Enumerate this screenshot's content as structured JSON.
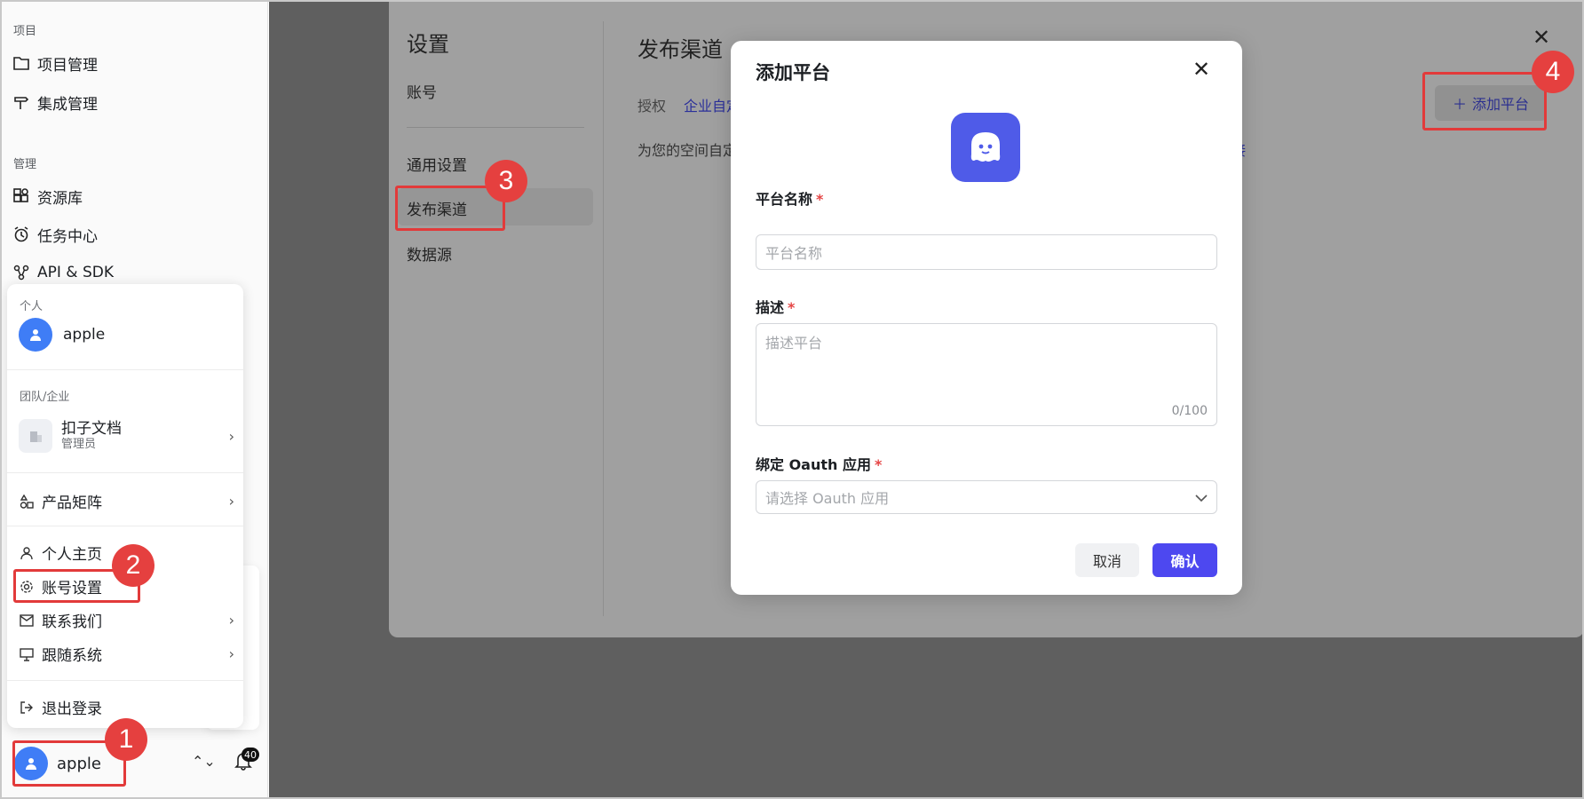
{
  "sidebar": {
    "section_project": "项目",
    "items_project": [
      {
        "label": "项目管理",
        "icon": "folder-icon"
      },
      {
        "label": "集成管理",
        "icon": "signpost-icon"
      }
    ],
    "section_manage": "管理",
    "items_manage": [
      {
        "label": "资源库",
        "icon": "blocks-icon"
      },
      {
        "label": "任务中心",
        "icon": "alarm-icon"
      },
      {
        "label": "API & SDK",
        "icon": "nodes-icon"
      }
    ],
    "user": {
      "name": "apple",
      "notification_count": "40"
    }
  },
  "account_menu": {
    "personal_label": "个人",
    "personal_name": "apple",
    "team_label": "团队/企业",
    "team": {
      "name": "扣子文档",
      "role": "管理员"
    },
    "items": [
      {
        "label": "产品矩阵",
        "icon": "shapes-icon"
      },
      {
        "label": "个人主页",
        "icon": "user-icon"
      },
      {
        "label": "账号设置",
        "icon": "gear-icon"
      },
      {
        "label": "联系我们",
        "icon": "mail-icon"
      },
      {
        "label": "跟随系统",
        "icon": "monitor-icon"
      },
      {
        "label": "退出登录",
        "icon": "logout-icon"
      }
    ]
  },
  "settings": {
    "title": "设置",
    "nav": [
      "账号",
      "通用设置",
      "发布渠道",
      "数据源"
    ],
    "section_title": "发布渠道",
    "auth_label": "授权",
    "auth_link": "企业自定",
    "desc_partial": "为您的空间自定",
    "desc_link_tail": "接",
    "add_platform": "添加平台"
  },
  "modal": {
    "title": "添加平台",
    "name_label": "平台名称",
    "name_placeholder": "平台名称",
    "desc_label": "描述",
    "desc_placeholder": "描述平台",
    "desc_counter": "0/100",
    "oauth_label": "绑定 Oauth 应用",
    "oauth_placeholder": "请选择 Oauth 应用",
    "cancel": "取消",
    "confirm": "确认",
    "required_mark": "*"
  },
  "annotations": {
    "badge1": "1",
    "badge2": "2",
    "badge3": "3",
    "badge4": "4"
  },
  "colors": {
    "accent": "#4d48f0",
    "annotation": "#e5403f",
    "avatar": "#3f7df6"
  }
}
